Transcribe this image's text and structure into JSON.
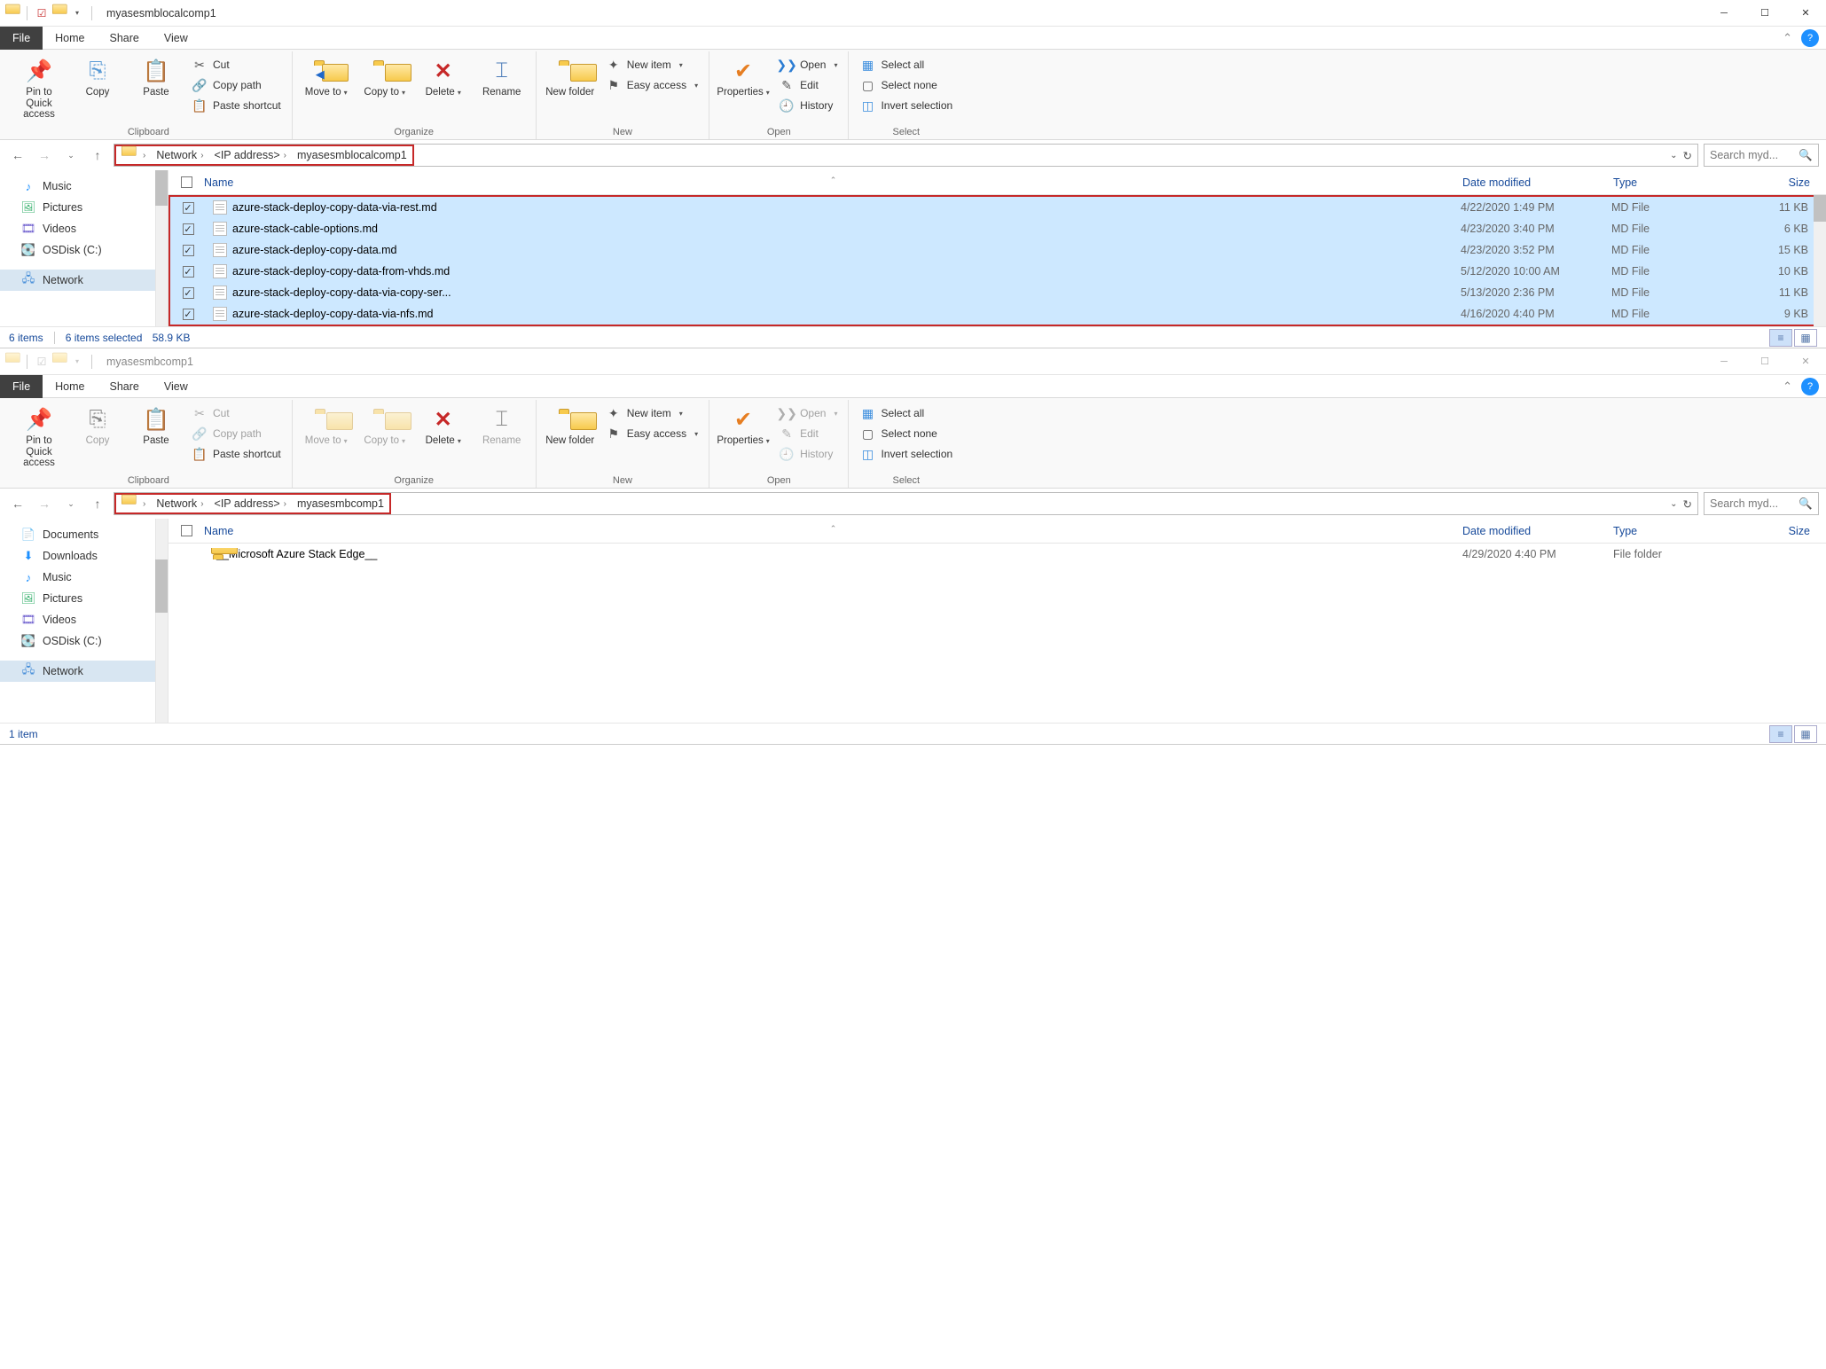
{
  "windows": [
    {
      "title": "myasesmblocalcomp1",
      "tabs": {
        "file": "File",
        "home": "Home",
        "share": "Share",
        "view": "View"
      },
      "ribbon": {
        "clipboard": {
          "label": "Clipboard",
          "pin": "Pin to Quick access",
          "copy": "Copy",
          "paste": "Paste",
          "cut": "Cut",
          "copypath": "Copy path",
          "pasteshortcut": "Paste shortcut"
        },
        "organize": {
          "label": "Organize",
          "moveto": "Move to",
          "copyto": "Copy to",
          "delete": "Delete",
          "rename": "Rename"
        },
        "new": {
          "label": "New",
          "newfolder": "New folder",
          "newitem": "New item",
          "easyaccess": "Easy access"
        },
        "open": {
          "label": "Open",
          "properties": "Properties",
          "open": "Open",
          "edit": "Edit",
          "history": "History"
        },
        "select": {
          "label": "Select",
          "all": "Select all",
          "none": "Select none",
          "invert": "Invert selection"
        }
      },
      "breadcrumb": {
        "network": "Network",
        "ip": "<IP address>",
        "folder": "myasesmblocalcomp1"
      },
      "search_placeholder": "Search myd...",
      "tree": {
        "music": "Music",
        "pictures": "Pictures",
        "videos": "Videos",
        "osdisk": "OSDisk (C:)",
        "network": "Network"
      },
      "columns": {
        "name": "Name",
        "date": "Date modified",
        "type": "Type",
        "size": "Size"
      },
      "files": [
        {
          "name": "azure-stack-deploy-copy-data-via-rest.md",
          "date": "4/22/2020 1:49 PM",
          "type": "MD File",
          "size": "11 KB"
        },
        {
          "name": "azure-stack-cable-options.md",
          "date": "4/23/2020 3:40 PM",
          "type": "MD File",
          "size": "6 KB"
        },
        {
          "name": "azure-stack-deploy-copy-data.md",
          "date": "4/23/2020 3:52 PM",
          "type": "MD File",
          "size": "15 KB"
        },
        {
          "name": "azure-stack-deploy-copy-data-from-vhds.md",
          "date": "5/12/2020 10:00 AM",
          "type": "MD File",
          "size": "10 KB"
        },
        {
          "name": "azure-stack-deploy-copy-data-via-copy-ser...",
          "date": "5/13/2020 2:36 PM",
          "type": "MD File",
          "size": "11 KB"
        },
        {
          "name": "azure-stack-deploy-copy-data-via-nfs.md",
          "date": "4/16/2020 4:40 PM",
          "type": "MD File",
          "size": "9 KB"
        }
      ],
      "status": {
        "items": "6 items",
        "selected": "6 items selected",
        "size": "58.9 KB"
      }
    },
    {
      "title": "myasesmbcomp1",
      "tabs": {
        "file": "File",
        "home": "Home",
        "share": "Share",
        "view": "View"
      },
      "ribbon": {
        "clipboard": {
          "label": "Clipboard",
          "pin": "Pin to Quick access",
          "copy": "Copy",
          "paste": "Paste",
          "cut": "Cut",
          "copypath": "Copy path",
          "pasteshortcut": "Paste shortcut"
        },
        "organize": {
          "label": "Organize",
          "moveto": "Move to",
          "copyto": "Copy to",
          "delete": "Delete",
          "rename": "Rename"
        },
        "new": {
          "label": "New",
          "newfolder": "New folder",
          "newitem": "New item",
          "easyaccess": "Easy access"
        },
        "open": {
          "label": "Open",
          "properties": "Properties",
          "open": "Open",
          "edit": "Edit",
          "history": "History"
        },
        "select": {
          "label": "Select",
          "all": "Select all",
          "none": "Select none",
          "invert": "Invert selection"
        }
      },
      "breadcrumb": {
        "network": "Network",
        "ip": "<IP address>",
        "folder": "myasesmbcomp1"
      },
      "search_placeholder": "Search myd...",
      "tree": {
        "documents": "Documents",
        "downloads": "Downloads",
        "music": "Music",
        "pictures": "Pictures",
        "videos": "Videos",
        "osdisk": "OSDisk (C:)",
        "network": "Network"
      },
      "columns": {
        "name": "Name",
        "date": "Date modified",
        "type": "Type",
        "size": "Size"
      },
      "files": [
        {
          "name": "__Microsoft Azure Stack Edge__",
          "date": "4/29/2020 4:40 PM",
          "type": "File folder",
          "size": ""
        }
      ],
      "status": {
        "items": "1 item"
      }
    }
  ]
}
